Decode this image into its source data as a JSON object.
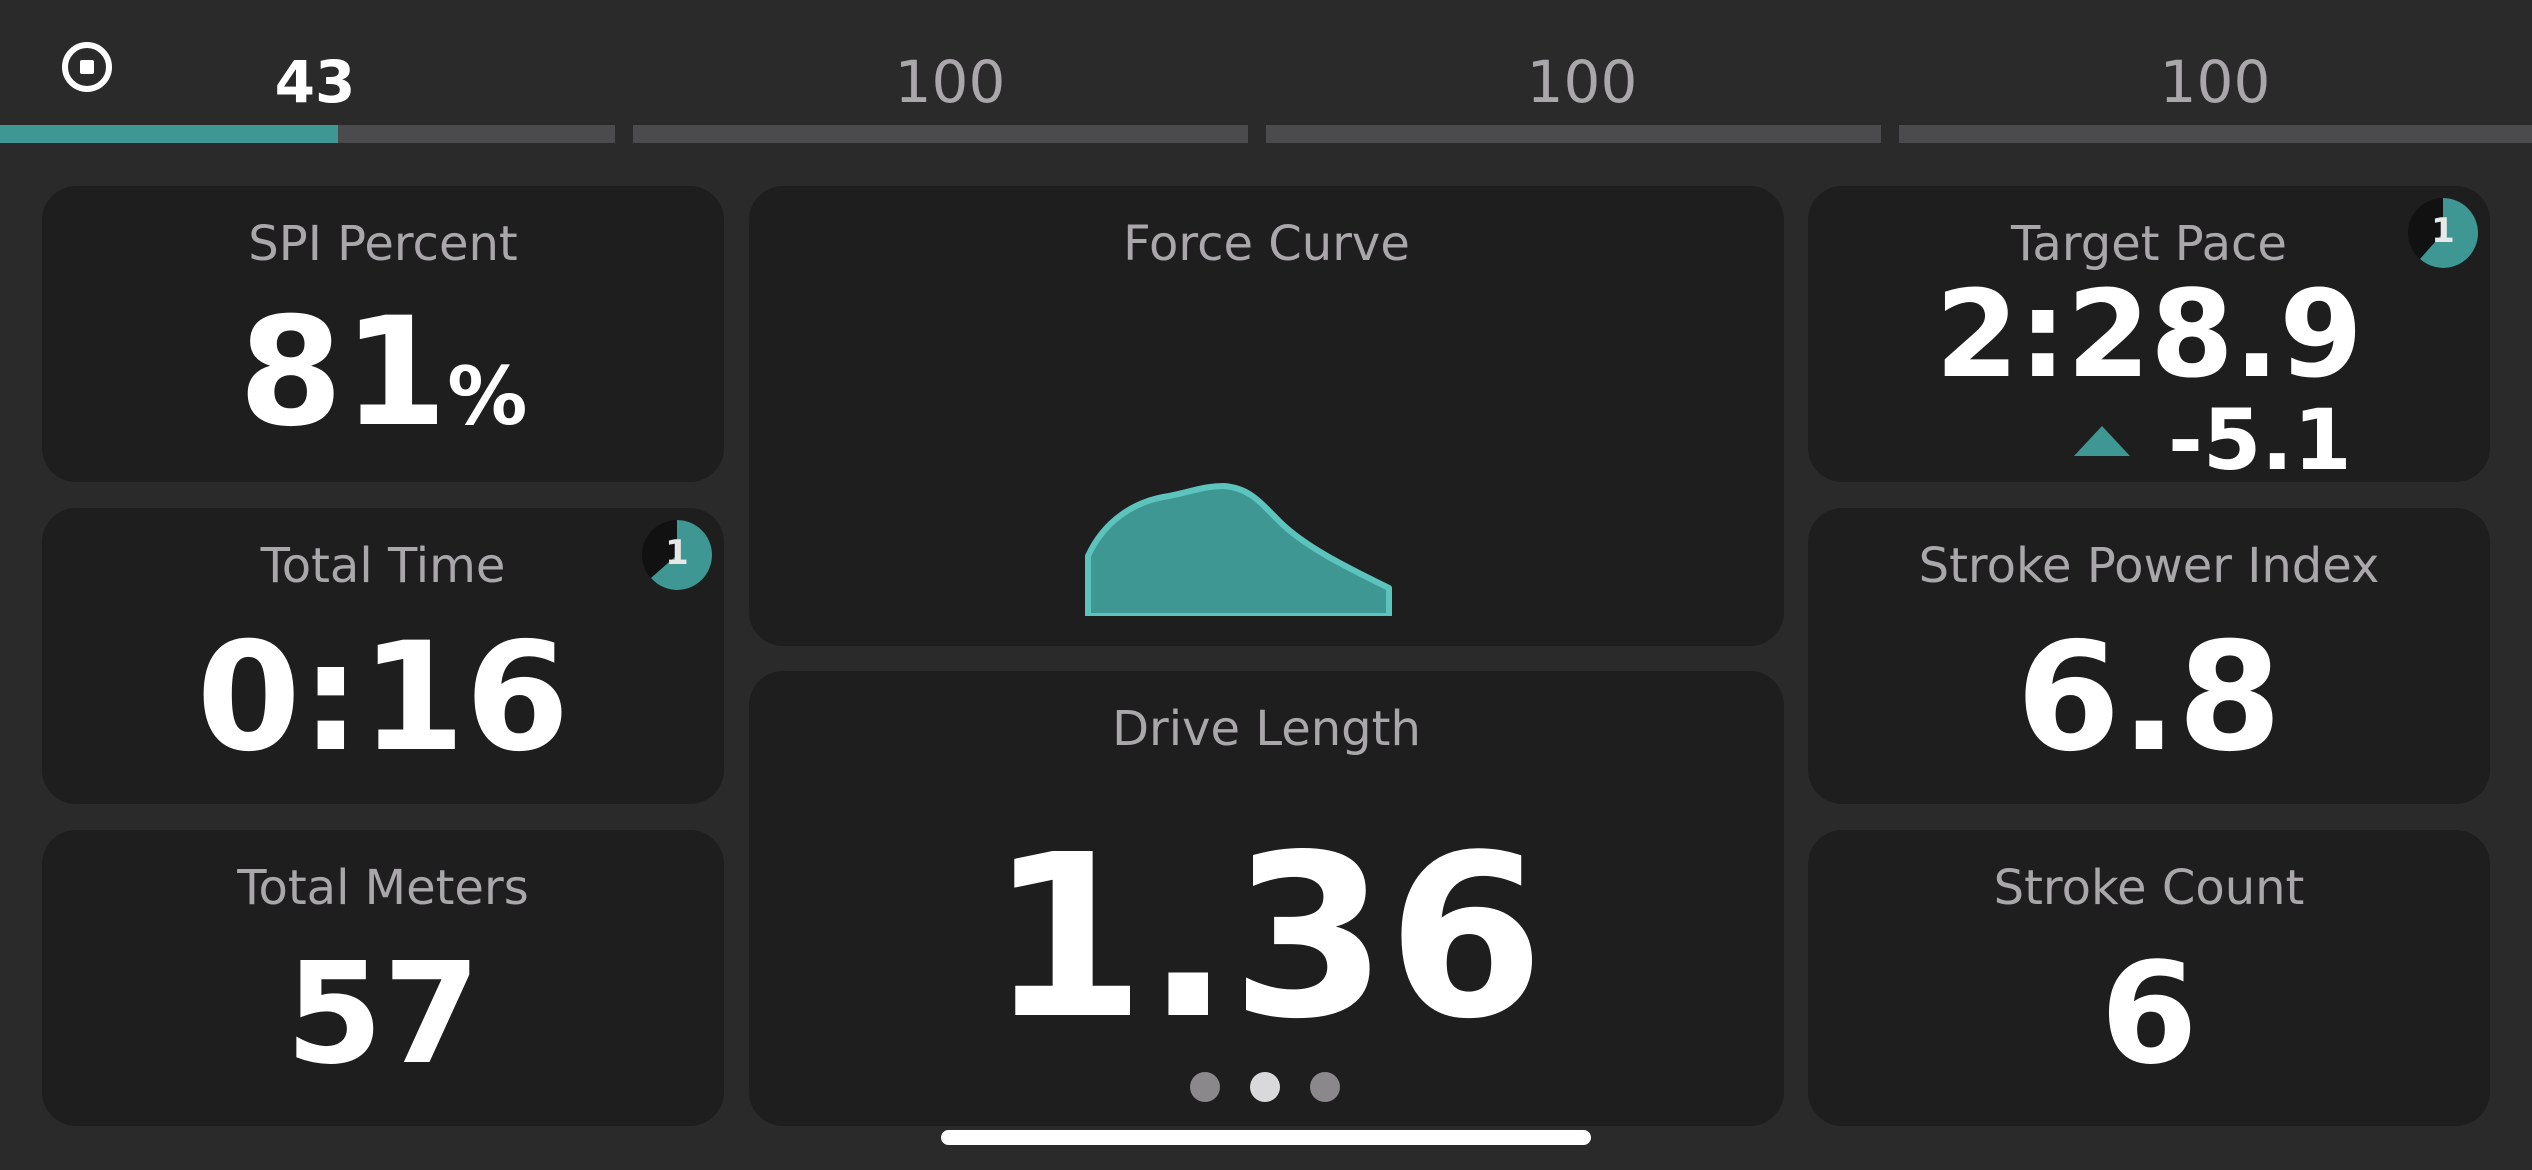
{
  "progress": {
    "segments": [
      {
        "label": "43",
        "active": true,
        "fill_fraction": 0.55
      },
      {
        "label": "100",
        "active": false,
        "fill_fraction": 0
      },
      {
        "label": "100",
        "active": false,
        "fill_fraction": 0
      },
      {
        "label": "100",
        "active": false,
        "fill_fraction": 0
      }
    ]
  },
  "cards": {
    "spi": {
      "title": "SPI Percent",
      "value": "81",
      "unit": "%"
    },
    "total_time": {
      "title": "Total Time",
      "value": "0:16",
      "badge": "1"
    },
    "total_meters": {
      "title": "Total Meters",
      "value": "57"
    },
    "force_curve": {
      "title": "Force Curve"
    },
    "drive_length": {
      "title": "Drive Length",
      "value": "1.36"
    },
    "target_pace": {
      "title": "Target Pace",
      "value": "2:28.9",
      "delta": "-5.1",
      "badge": "1"
    },
    "stroke_power_index": {
      "title": "Stroke Power Index",
      "value": "6.8"
    },
    "stroke_count": {
      "title": "Stroke Count",
      "value": "6"
    }
  },
  "pager": {
    "pages": 3,
    "current": 2
  },
  "colors": {
    "accent": "#3f9793",
    "accent_light": "#5cc4bd",
    "card_bg": "#1f1e1f",
    "bg": "#2b2a2b"
  }
}
